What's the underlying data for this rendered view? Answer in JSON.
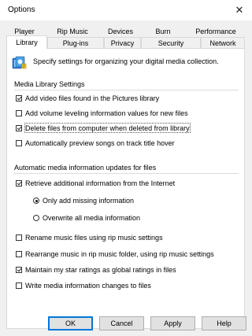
{
  "window": {
    "title": "Options",
    "close_label": "✕"
  },
  "tabs_row1": [
    {
      "label": "Player"
    },
    {
      "label": "Rip Music"
    },
    {
      "label": "Devices"
    },
    {
      "label": "Burn"
    },
    {
      "label": "Performance"
    }
  ],
  "tabs_row2": [
    {
      "label": "Library",
      "selected": true
    },
    {
      "label": "Plug-ins"
    },
    {
      "label": "Privacy"
    },
    {
      "label": "Security"
    },
    {
      "label": "Network"
    }
  ],
  "header": {
    "text": "Specify settings for organizing your digital media collection.",
    "icon": "library-icon"
  },
  "media_library": {
    "title": "Media Library Settings",
    "options": [
      {
        "label": "Add video files found in the Pictures library",
        "checked": true
      },
      {
        "label": "Add volume leveling information values for new files",
        "checked": false
      },
      {
        "label": "Delete files from computer when deleted from library",
        "checked": true
      },
      {
        "label": "Automatically preview songs on track title hover",
        "checked": false
      }
    ]
  },
  "auto_updates": {
    "title": "Automatic media information updates for files",
    "retrieve": {
      "label": "Retrieve additional information from the Internet",
      "checked": true
    },
    "radios": [
      {
        "label": "Only add missing information",
        "selected": true
      },
      {
        "label": "Overwrite all media information",
        "selected": false
      }
    ],
    "options": [
      {
        "label": "Rename music files using rip music settings",
        "checked": false
      },
      {
        "label": "Rearrange music in rip music folder, using rip music settings",
        "checked": false
      },
      {
        "label": "Maintain my star ratings as global ratings in files",
        "checked": true
      },
      {
        "label": "Write media information changes to files",
        "checked": false
      }
    ]
  },
  "buttons": {
    "ok": "OK",
    "cancel": "Cancel",
    "apply": "Apply",
    "help": "Help"
  }
}
